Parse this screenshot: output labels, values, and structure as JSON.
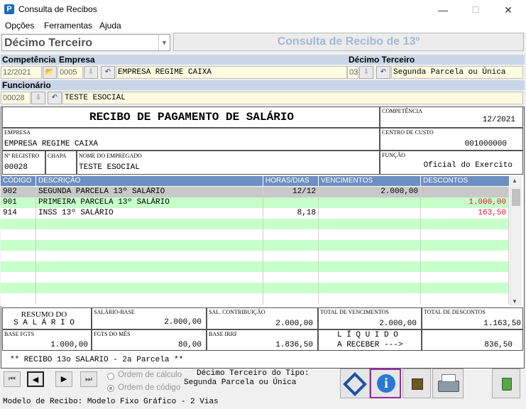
{
  "window": {
    "title": "Consulta de Recibos",
    "minimize": "—",
    "maximize": "☐",
    "close": "✕"
  },
  "menu": {
    "items": [
      "Opções",
      "Ferramentas",
      "Ajuda"
    ]
  },
  "header": {
    "type_select": "Décimo Terceiro",
    "title": "Consulta de Recibo de 13º"
  },
  "filters": {
    "competencia_label": "Competência",
    "competencia_value": "12/2021",
    "empresa_label": "Empresa",
    "empresa_code": "0005",
    "empresa_name": "EMPRESA REGIME CAIXA",
    "decimo_label": "Décimo Terceiro",
    "decimo_code": "03",
    "decimo_name": "Segunda Parcela ou Única",
    "funcionario_label": "Funcionário",
    "funcionario_code": "00028",
    "funcionario_name": "TESTE ESOCIAL"
  },
  "receipt": {
    "title": "RECIBO DE PAGAMENTO DE SALÁRIO",
    "competencia_label": "COMPETÊNCIA",
    "competencia_value": "12/2021",
    "empresa_label": "EMPRESA",
    "empresa_value": "EMPRESA REGIME CAIXA",
    "centro_label": "CENTRO DE CUSTO",
    "centro_value": "001000000",
    "registro_label": "Nº REGISTRO",
    "registro_value": "00028",
    "chapa_label": "CHAPA",
    "nome_label": "NOME DO EMPREGADO",
    "nome_value": "TESTE ESOCIAL",
    "funcao_label": "FUNÇÃO",
    "funcao_value": "Oficial do Exercito"
  },
  "grid": {
    "headers": [
      "CÓDIGO",
      "DESCRIÇÃO",
      "HORAS/DIAS",
      "VENCIMENTOS",
      "DESCONTOS"
    ],
    "rows": [
      {
        "code": "902",
        "desc": "SEGUNDA PARCELA 13º SALÁRIO",
        "horas": "12/12",
        "venc": "2.000,00",
        "desc_val": ""
      },
      {
        "code": "901",
        "desc": "PRIMEIRA PARCELA 13º SALÁRIO",
        "horas": "",
        "venc": "",
        "desc_val": "1.000,00"
      },
      {
        "code": "914",
        "desc": "INSS 13º SALÁRIO",
        "horas": "8,18",
        "venc": "",
        "desc_val": "163,50"
      }
    ]
  },
  "summary": {
    "resumo_line1": "RESUMO DO",
    "resumo_line2": "S A L Á R I O",
    "salario_base_label": "SALÁRIO-BASE",
    "salario_base_value": "2.000,00",
    "sal_contrib_label": "SAL. CONTRIBUIÇÃO",
    "sal_contrib_value": "2.000,00",
    "total_venc_label": "TOTAL DE VENCIMENTOS",
    "total_venc_value": "2.000,00",
    "total_desc_label": "TOTAL DE DESCONTOS",
    "total_desc_value": "1.163,50",
    "base_fgts_label": "BASE FGTS",
    "base_fgts_value": "1.000,00",
    "fgts_mes_label": "FGTS DO MÊS",
    "fgts_mes_value": "80,00",
    "base_irrf_label": "BASE IRRF",
    "base_irrf_value": "1.836,50",
    "liquido_line1": "L Í Q U I D O",
    "liquido_line2": "A RECEBER --->",
    "liquido_value": "836,50",
    "note": "** RECIBO 13o SALARIO - 2a Parcela **"
  },
  "footer": {
    "ordem_calculo": "Ordem de cálculo",
    "ordem_codigo": "Ordem de código",
    "tipo_line1": "Décimo Terceiro do Tipo:",
    "tipo_line2": "Segunda Parcela ou Única",
    "status": "Modelo de Recibo: Modelo Fixo Gráfico - 2 Vias"
  },
  "colors": {
    "accent": "#6d8fc2",
    "row_green": "#c6ffc9",
    "discount_red": "#e0142c"
  }
}
